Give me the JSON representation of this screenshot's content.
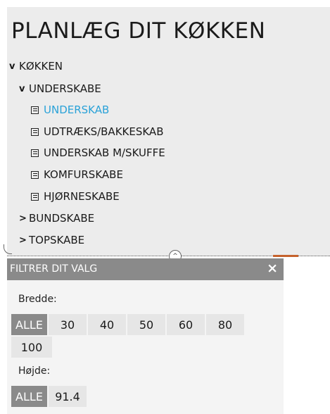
{
  "title": "PLANLÆG DIT KØKKEN",
  "tree": {
    "root": {
      "caret": "v",
      "label": "KØKKEN"
    },
    "underskabe": {
      "caret": "v",
      "label": "UNDERSKABE"
    },
    "items": [
      {
        "label": "UNDERSKAB",
        "active": true
      },
      {
        "label": "UDTRÆKS/BAKKESKAB"
      },
      {
        "label": "UNDERSKAB M/SKUFFE"
      },
      {
        "label": "KOMFURSKABE"
      },
      {
        "label": "HJØRNESKABE"
      }
    ],
    "bundskabe": {
      "caret": ">",
      "label": "BUNDSKABE"
    },
    "topskabe": {
      "caret": ">",
      "label": "TOPSKABE"
    }
  },
  "colors": {
    "active_link": "#2aa2d8",
    "header_grey": "#8a8a8a",
    "accent_orange": "#c5622c"
  },
  "filter": {
    "title": "FILTRER DIT VALG",
    "close": "×",
    "bredde": {
      "label": "Bredde:",
      "options": [
        "ALLE",
        "30",
        "40",
        "50",
        "60",
        "80",
        "100"
      ],
      "selected": "ALLE"
    },
    "hojde": {
      "label": "Højde:",
      "options": [
        "ALLE",
        "91.4"
      ],
      "selected": "ALLE"
    }
  },
  "icons": {
    "collapse": "chevron-up-icon",
    "doc": "document-icon"
  }
}
